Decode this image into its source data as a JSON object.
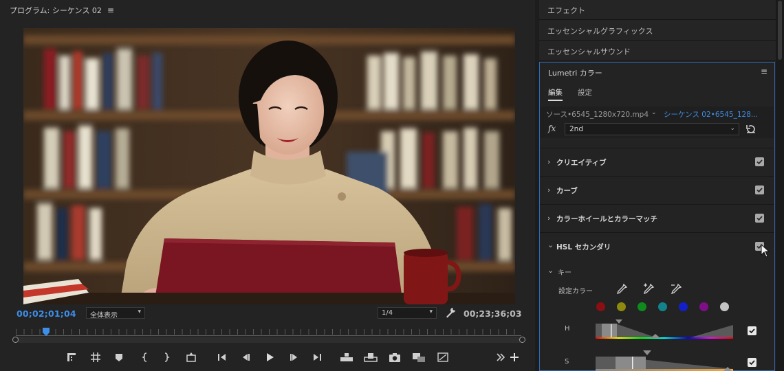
{
  "program_monitor": {
    "title": "プログラム: シーケンス 02",
    "current_timecode": "00;02;01;04",
    "zoom_value": "全体表示",
    "resolution_value": "1/4",
    "duration_timecode": "00;23;36;03",
    "video_preview": {
      "icon": "video-frame",
      "playhead_position": 0.06
    }
  },
  "transport": {
    "buttons": [
      "marker-icon",
      "trim-icon",
      "add-marker-icon",
      "mark-in-icon",
      "mark-out-icon",
      "lift-icon",
      "go-to-in-icon",
      "step-back-icon",
      "play-icon",
      "step-forward-icon",
      "go-to-out-icon",
      "insert-icon",
      "overwrite-icon",
      "export-frame-icon",
      "compare-view-icon",
      "safe-margins-icon",
      "more-icon",
      "add-icon"
    ]
  },
  "right_panels": {
    "tabs": [
      {
        "label": "エフェクト"
      },
      {
        "label": "エッセンシャルグラフィックス"
      },
      {
        "label": "エッセンシャルサウンド"
      }
    ]
  },
  "lumetri": {
    "title": "Lumetri カラー",
    "tabs": {
      "edit": "編集",
      "settings": "設定"
    },
    "source_label": "ソース•6545_1280x720.mp4",
    "sequence_label": "シーケンス 02•6545_128...",
    "fx_label": "fx",
    "preset_value": "2nd",
    "sections": [
      {
        "label": "クリエイティブ",
        "checked": true
      },
      {
        "label": "カーブ",
        "checked": true
      },
      {
        "label": "カラーホイールとカラーマッチ",
        "checked": true
      },
      {
        "label": "HSL セカンダリ",
        "checked": true,
        "expanded": true
      }
    ],
    "key": {
      "label": "キー",
      "set_color_label": "設定カラー",
      "swatch_colors": [
        "#8b0f12",
        "#8f8a0e",
        "#0f8b1d",
        "#12838a",
        "#1320c9",
        "#7f0f86",
        "#c4c4c4"
      ],
      "h_label": "H",
      "s_label": "S"
    }
  }
}
